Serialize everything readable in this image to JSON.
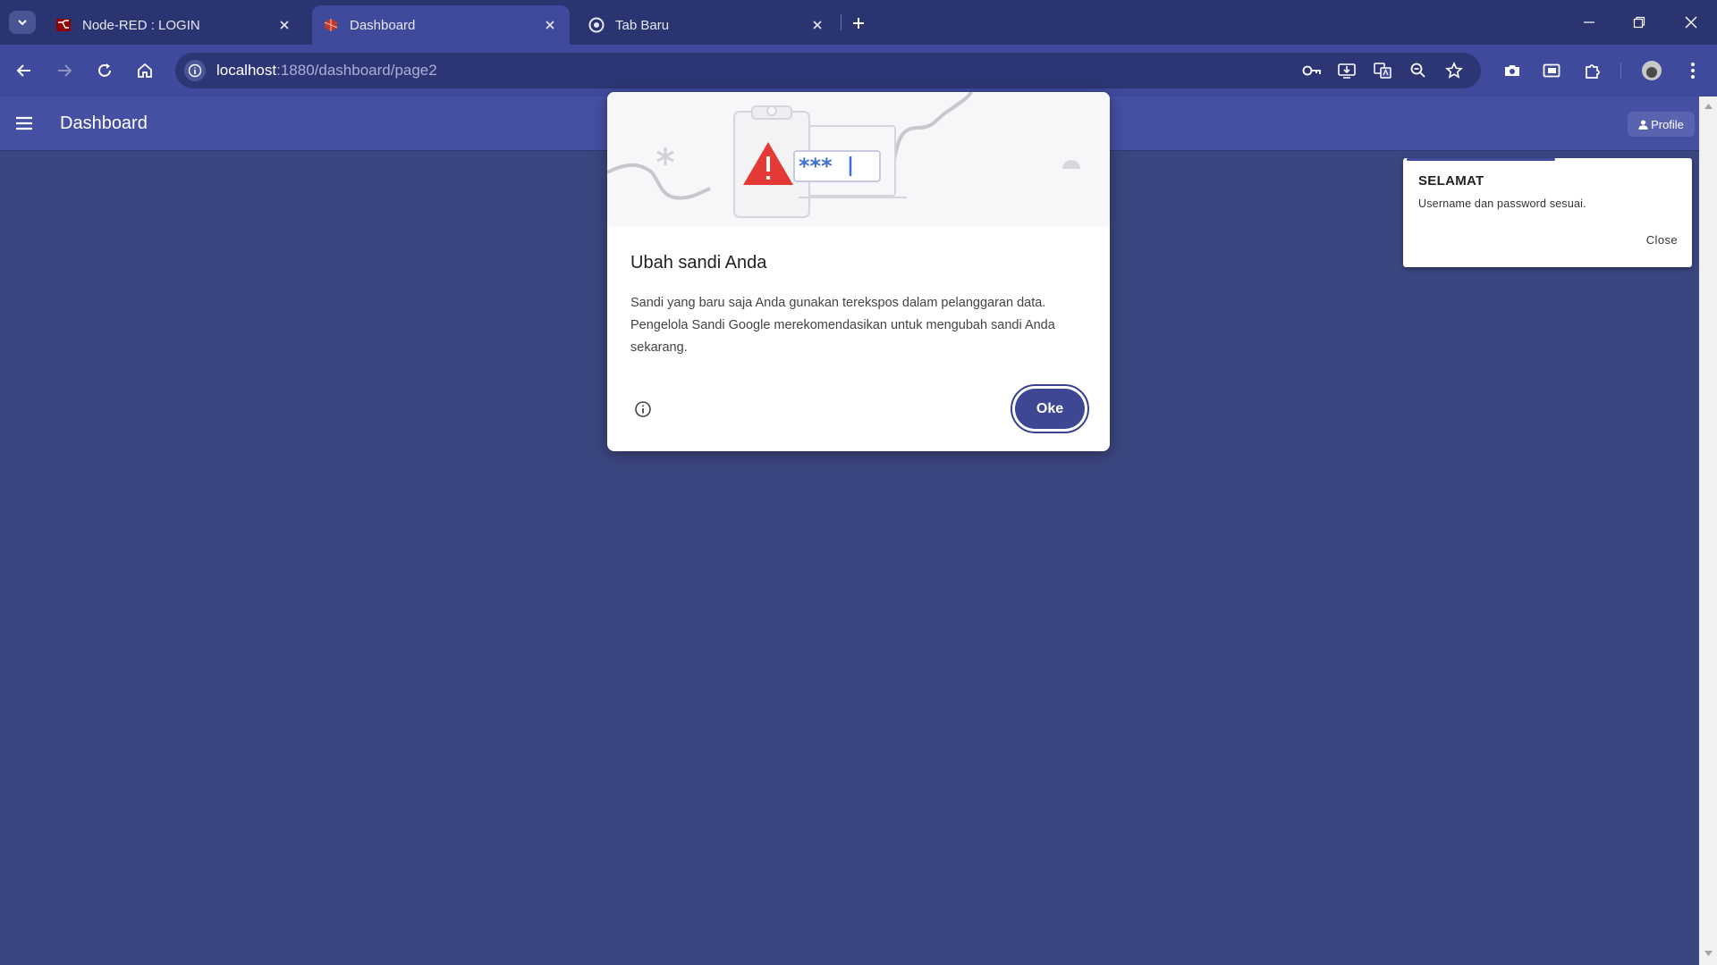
{
  "browser": {
    "tabs": [
      {
        "title": "Node-RED : LOGIN",
        "icon": "node-red-icon"
      },
      {
        "title": "Dashboard",
        "icon": "dashboard-favicon-icon",
        "active": true
      },
      {
        "title": "Tab Baru",
        "icon": "chrome-icon"
      }
    ],
    "address": {
      "host": "localhost",
      "path": ":1880/dashboard/page2"
    },
    "accent_color": "#3f4a9c"
  },
  "app": {
    "title": "Dashboard",
    "profile_label": "Profile",
    "background_color": "#3b4680"
  },
  "toast": {
    "title": "SELAMAT",
    "message": "Username dan password sesuai.",
    "close_label": "Close"
  },
  "dialog": {
    "title": "Ubah sandi Anda",
    "body": "Sandi yang baru saja Anda gunakan terekspos dalam pelanggaran data. Pengelola Sandi Google merekomendasikan untuk mengubah sandi Anda sekarang.",
    "ok_label": "Oke",
    "illustration_mask": "***"
  }
}
